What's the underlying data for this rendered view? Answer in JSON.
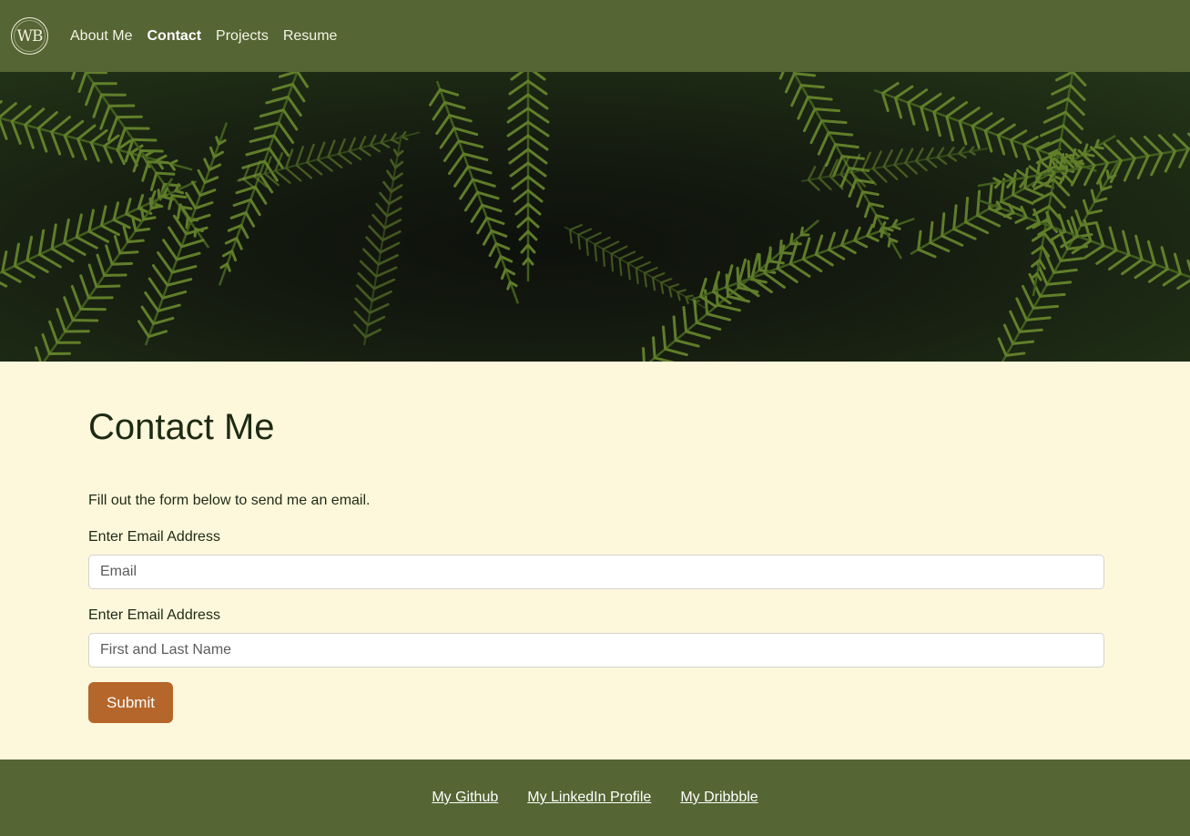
{
  "nav": {
    "logo_text": "WB",
    "links": [
      {
        "label": "About Me",
        "active": false
      },
      {
        "label": "Contact",
        "active": true
      },
      {
        "label": "Projects",
        "active": false
      },
      {
        "label": "Resume",
        "active": false
      }
    ]
  },
  "hero": {
    "image": "fern-leaves-photo"
  },
  "main": {
    "title": "Contact Me",
    "intro": "Fill out the form below to send me an email.",
    "email_label": "Enter Email Address",
    "email_placeholder": "Email",
    "email_value": "",
    "name_label": "Enter Email Address",
    "name_placeholder": "First and Last Name",
    "name_value": "",
    "submit_label": "Submit"
  },
  "footer": {
    "links": [
      {
        "label": "My Github"
      },
      {
        "label": "My LinkedIn Profile"
      },
      {
        "label": "My Dribbble"
      }
    ]
  },
  "colors": {
    "nav_bg": "#556533",
    "page_bg": "#fdf8dc",
    "button_bg": "#b5662a",
    "text": "#1f2a14"
  }
}
